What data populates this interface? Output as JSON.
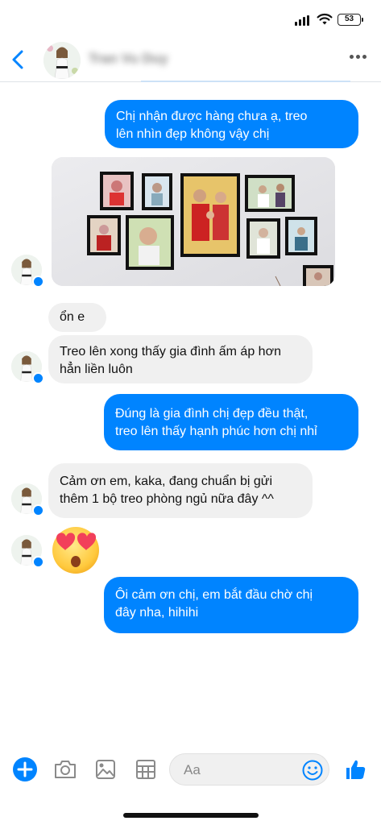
{
  "status_bar": {
    "battery": "53"
  },
  "header": {
    "contact_name": "Tran Vu Duy"
  },
  "messages": [
    {
      "side": "sent",
      "text": "Chị nhận được hàng chưa ạ, treo\nlên nhìn đẹp không vậy chị"
    },
    {
      "side": "recv",
      "type": "photo",
      "icon": "framed-family-photos"
    },
    {
      "side": "recv",
      "text": "ổn e"
    },
    {
      "side": "recv",
      "text": "Treo lên xong thấy gia đình ấm áp hơn\nhẳn liền luôn"
    },
    {
      "side": "sent",
      "text": "Đúng là gia đình chị đẹp đều thật,\ntreo lên thấy hạnh phúc hơn chị nhỉ"
    },
    {
      "side": "recv",
      "text": "Cảm ơn em, kaka, đang chuẩn bị gửi\nthêm 1 bộ treo phòng ngủ nữa đây ^^"
    },
    {
      "side": "recv",
      "type": "emoji",
      "icon": "heart-eyes-emoji"
    },
    {
      "side": "sent",
      "text": "Ôi cảm ơn chị, em bắt đầu chờ chị\nđây nha, hihihi"
    }
  ],
  "composer": {
    "placeholder": "Aa",
    "icons": [
      "plus-icon",
      "camera-icon",
      "gallery-icon",
      "sticker-grid-icon",
      "emoji-icon",
      "thumbs-up-icon"
    ]
  },
  "colors": {
    "accent": "#0084ff",
    "received_bubble": "#f0f0f0"
  }
}
